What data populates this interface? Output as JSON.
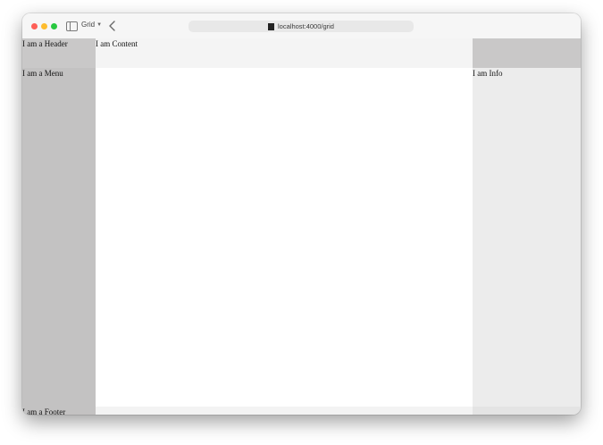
{
  "browser": {
    "tab_group_label": "Grid",
    "address": "localhost:4000/grid"
  },
  "grid": {
    "header": "I am a Header",
    "content": "I am Content",
    "menu": "I am a Menu",
    "info": "I am Info",
    "footer": "I am a Footer"
  }
}
